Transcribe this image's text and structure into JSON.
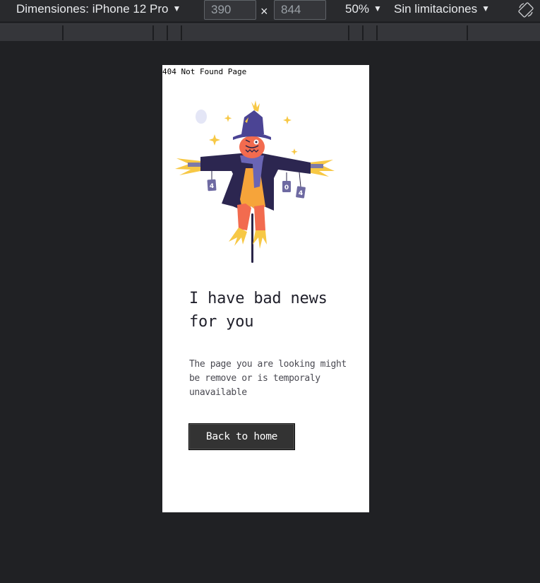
{
  "toolbar": {
    "device_label": "Dimensiones: iPhone 12 Pro",
    "width_value": "390",
    "times_symbol": "×",
    "height_value": "844",
    "zoom_label": "50%",
    "throttle_label": "Sin limitaciones",
    "caret": "▼",
    "rotate_icon": "rotate-icon"
  },
  "page": {
    "doc_title": "404 Not Found Page",
    "illustration_icon": "scarecrow-illustration",
    "sign_digits": [
      "4",
      "0",
      "4"
    ],
    "heading": "I have bad news for you",
    "description": "The page you are looking might be remove or is temporaly unavailable",
    "button_label": "Back to home"
  },
  "colors": {
    "devtools_bg": "#202124",
    "toolbar_bg": "#292a2d",
    "page_bg": "#ffffff",
    "button_bg": "#333333",
    "scarecrow_coat": "#2c2650",
    "scarecrow_face": "#f26b4f",
    "straw": "#f7c845",
    "hat": "#4b4494"
  }
}
